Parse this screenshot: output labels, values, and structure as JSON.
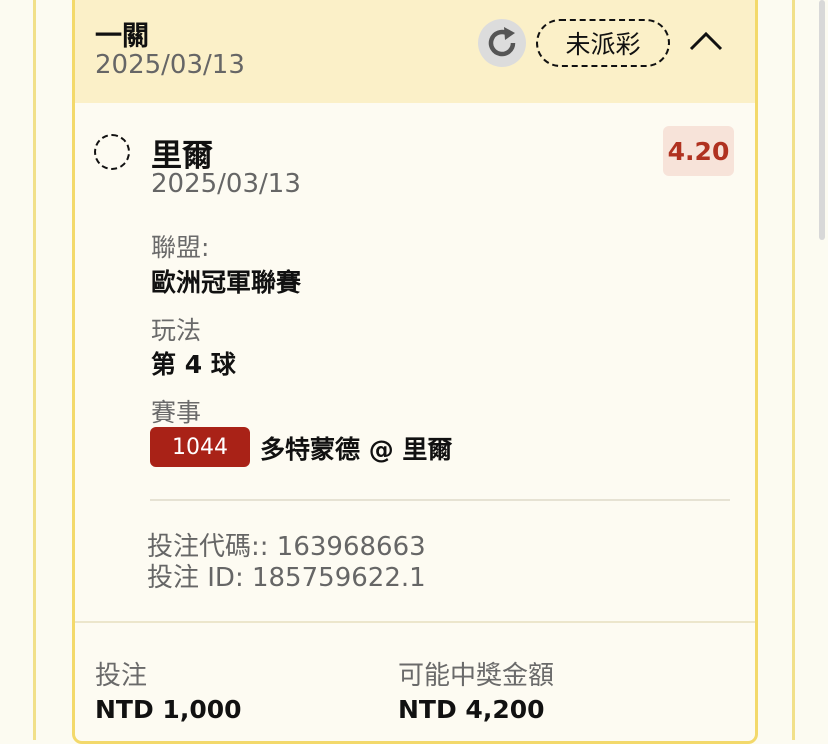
{
  "header": {
    "title": "一關",
    "date": "2025/03/13",
    "status": "未派彩"
  },
  "selection": {
    "name": "里爾",
    "date": "2025/03/13",
    "odds": "4.20"
  },
  "details": {
    "league_label": "聯盟:",
    "league_value": "歐洲冠軍聯賽",
    "play_label": "玩法",
    "play_value": "第 4 球",
    "event_label": "賽事",
    "event_number": "1044",
    "event_name": "多特蒙德 @ 里爾"
  },
  "refs": {
    "bet_code": "投注代碼:: 163968663",
    "bet_id": "投注 ID: 185759622.1"
  },
  "footer": {
    "stake_label": "投注",
    "stake_value": "NTD 1,000",
    "payout_label": "可能中獎金額",
    "payout_value": "NTD 4,200"
  },
  "colors": {
    "header_bg": "#fbf0c8",
    "card_border": "#f3d96b",
    "odds_text": "#b03220",
    "event_badge": "#a92217"
  },
  "icons": [
    "refresh-icon",
    "chevron-up-icon"
  ]
}
